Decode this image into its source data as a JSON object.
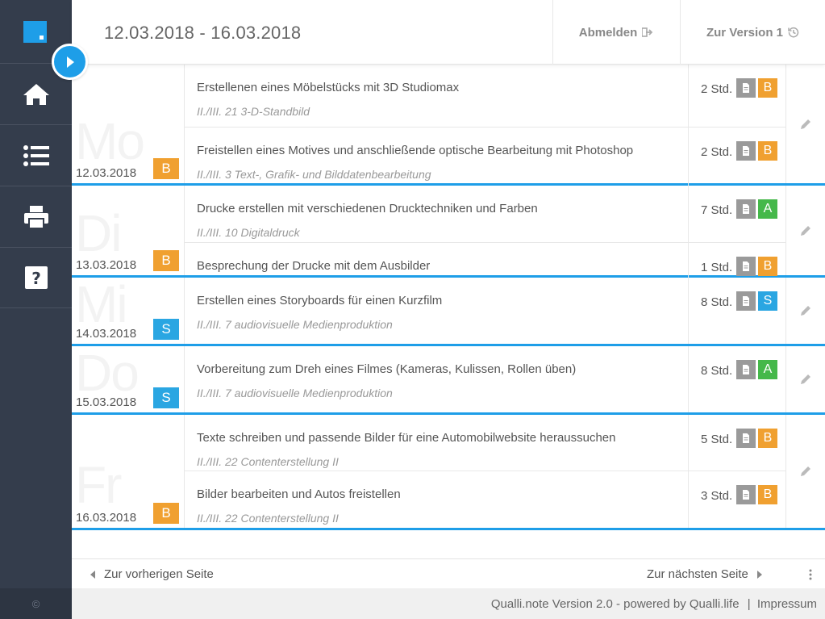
{
  "sidebar": {
    "copyright": "©",
    "items": [
      {
        "icon": "home-icon"
      },
      {
        "icon": "list-icon"
      },
      {
        "icon": "print-icon"
      },
      {
        "icon": "help-icon"
      }
    ]
  },
  "header": {
    "title": "12.03.2018 - 16.03.2018",
    "logout_label": "Abmelden",
    "version_label": "Zur Version 1"
  },
  "days": [
    {
      "weekday": "Mo",
      "date": "12.03.2018",
      "grade": "B",
      "entries": [
        {
          "title": "Erstellenen eines Möbelstücks mit 3D Studiomax",
          "subtitle": "II./III. 21 3-D-Standbild",
          "hours": "2 Std.",
          "grade": "B"
        },
        {
          "title": "Freistellen eines Motives und anschließende optische Bearbeitung mit Photoshop",
          "subtitle": "II./III. 3 Text-, Grafik- und Bilddatenbearbeitung",
          "hours": "2 Std.",
          "grade": "B"
        }
      ]
    },
    {
      "weekday": "Di",
      "date": "13.03.2018",
      "grade": "B",
      "entries": [
        {
          "title": "Drucke erstellen mit verschiedenen Drucktechniken und Farben",
          "subtitle": "II./III. 10 Digitaldruck",
          "hours": "7 Std.",
          "grade": "A"
        },
        {
          "title": "Besprechung der Drucke mit dem Ausbilder",
          "subtitle": "",
          "hours": "1 Std.",
          "grade": "B"
        }
      ]
    },
    {
      "weekday": "Mi",
      "date": "14.03.2018",
      "grade": "S",
      "entries": [
        {
          "title": "Erstellen eines Storyboards für einen Kurzfilm",
          "subtitle": "II./III. 7 audiovisuelle Medienproduktion",
          "hours": "8 Std.",
          "grade": "S"
        }
      ]
    },
    {
      "weekday": "Do",
      "date": "15.03.2018",
      "grade": "S",
      "entries": [
        {
          "title": "Vorbereitung zum Dreh eines Filmes (Kameras, Kulissen, Rollen üben)",
          "subtitle": "II./III. 7 audiovisuelle Medienproduktion",
          "hours": "8 Std.",
          "grade": "A"
        }
      ]
    },
    {
      "weekday": "Fr",
      "date": "16.03.2018",
      "grade": "B",
      "entries": [
        {
          "title": "Texte schreiben und passende Bilder für eine Automobilwebsite heraussuchen",
          "subtitle": "II./III. 22 Contenterstellung II",
          "hours": "5 Std.",
          "grade": "B"
        },
        {
          "title": "Bilder bearbeiten und Autos freistellen",
          "subtitle": "II./III. 22 Contenterstellung II",
          "hours": "3 Std.",
          "grade": "B"
        }
      ]
    }
  ],
  "pager": {
    "prev_label": "Zur vorherigen Seite",
    "next_label": "Zur nächsten Seite"
  },
  "footer": {
    "text": "Qualli.note Version 2.0 - powered by Qualli.life",
    "separator": "|",
    "impressum": "Impressum"
  },
  "colors": {
    "accent": "#1e9ee8",
    "grade_B": "#f0a030",
    "grade_A": "#45b84a",
    "grade_S": "#2aa6e2",
    "sidebar": "#343d4c"
  }
}
